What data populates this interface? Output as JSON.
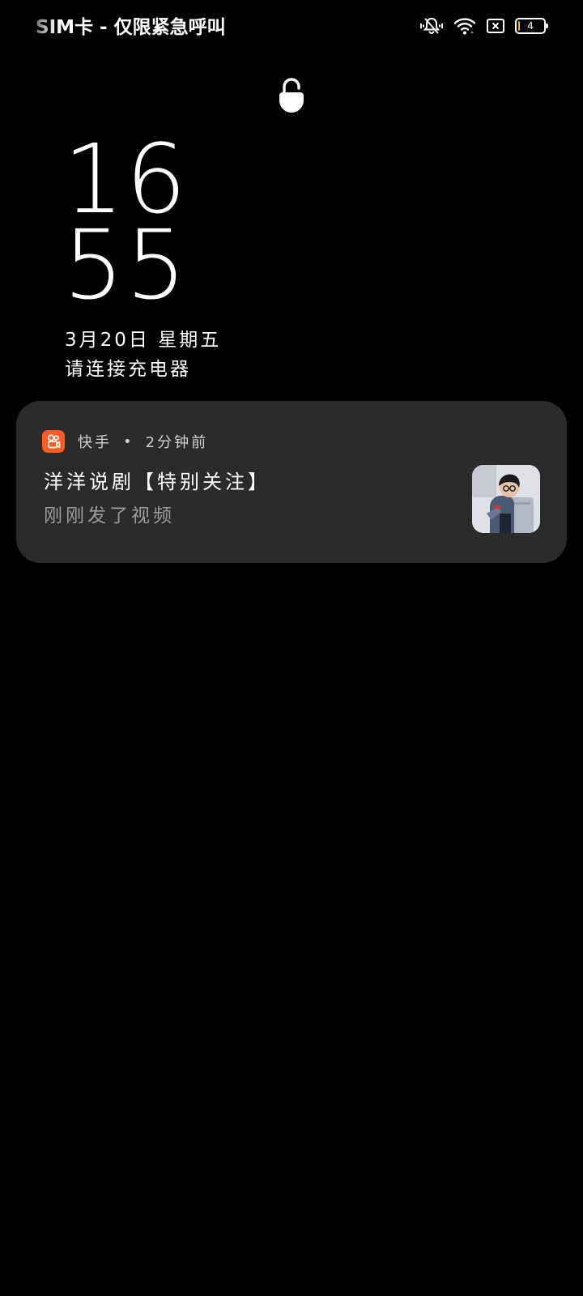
{
  "status_bar": {
    "carrier": "SIM卡 - 仅限紧急呼叫",
    "battery_level": "4",
    "battery_fraction": 0.04,
    "icons": [
      "bell-off-icon",
      "wifi-icon",
      "no-sim-icon",
      "battery-icon"
    ]
  },
  "lockscreen": {
    "lock_icon": "lock-open-icon",
    "clock_hour": "16",
    "clock_minute": "55",
    "date": "3月20日 星期五",
    "charging_hint": "请连接充电器"
  },
  "notification": {
    "app_name": "快手",
    "separator": "•",
    "time_ago": "2分钟前",
    "title": "洋洋说剧【特别关注】",
    "body": "刚刚发了视频",
    "app_icon_color": "#ff5a1f",
    "card_color": "#2b2b2b"
  }
}
